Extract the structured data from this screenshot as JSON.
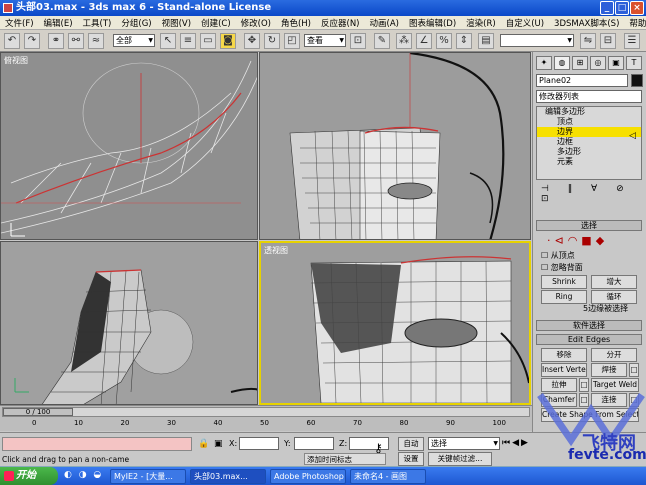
{
  "window": {
    "title": "头部03.max - 3ds max 6 - Stand-alone License"
  },
  "menu": [
    "文件(F)",
    "编辑(E)",
    "工具(T)",
    "分组(G)",
    "视图(V)",
    "创建(C)",
    "修改(O)",
    "角色(H)",
    "反应器(N)",
    "动画(A)",
    "图表编辑(D)",
    "渲染(R)",
    "自定义(U)",
    "3DSMAX脚本(S)",
    "帮助(H)"
  ],
  "toolbar": {
    "selection_filter": "全部",
    "ref_coord": "查看"
  },
  "viewports": {
    "top_left": "俯视图",
    "bottom_right": "透视图"
  },
  "command_panel": {
    "object_name": "Plane02",
    "modifier_list": "修改器列表",
    "stack": [
      {
        "label": "编辑多边形",
        "selected": false
      },
      {
        "label": "顶点",
        "selected": false
      },
      {
        "label": "边界",
        "selected": true
      },
      {
        "label": "边框",
        "selected": false
      },
      {
        "label": "多边形",
        "selected": false
      },
      {
        "label": "元素",
        "selected": false
      }
    ],
    "select_rollout": {
      "title": "选择",
      "by_vertex": "从顶点",
      "ignore_backface": "忽略背面",
      "shrink": "Shrink",
      "grow": "增大",
      "ring": "Ring",
      "loop": "循环",
      "info": "5边缘被选择"
    },
    "soft_select": "软件选择",
    "edit_edges": {
      "title": "Edit Edges",
      "remove": "移除",
      "split": "分开",
      "insert_vertex": "Insert Vertex",
      "weld": "焊接",
      "extrude": "拉伸",
      "target_weld": "Target Weld",
      "chamfer": "Chamfer",
      "connect": "连接",
      "create_shape": "Create Shape From Selection"
    }
  },
  "timeline": {
    "frame": "0 / 100",
    "ticks": [
      "0",
      "10",
      "20",
      "30",
      "40",
      "50",
      "60",
      "70",
      "80",
      "90",
      "100"
    ]
  },
  "status": {
    "x_label": "X:",
    "y_label": "Y:",
    "z_label": "Z:",
    "auto_key": "自动",
    "selected": "选择",
    "set_key": "设置",
    "key_filters": "关键帧过滤...",
    "prompt": "Click and drag to pan a non-came",
    "add_time_tag": "添加时间标志"
  },
  "taskbar": {
    "start": "开始",
    "tasks": [
      "MyIE2 - [大量...",
      "头部03.max...",
      "Adobe Photoshop",
      "未命名4 - 画图"
    ]
  },
  "watermark": {
    "text1": "飞特网",
    "text2": "fevte.com"
  }
}
